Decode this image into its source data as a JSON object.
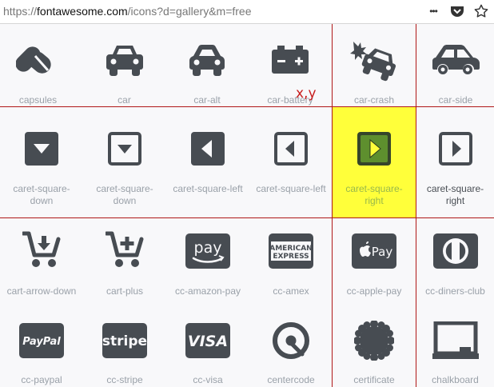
{
  "browser": {
    "url_prefix": "https://",
    "url_host": "fontawesome.com",
    "url_path": "/icons?d=gallery&m=free",
    "menu_glyph": "•••"
  },
  "annotation": {
    "coord_label": "x,y"
  },
  "colors": {
    "icon": "#474c52",
    "highlight": "#ffff3a",
    "grid_line": "#b01818"
  },
  "icons": {
    "row1": [
      "capsules",
      "car",
      "car-alt",
      "car-battery",
      "car-crash",
      "car-side"
    ],
    "row2": [
      "caret-square-\ndown",
      "caret-square-\ndown",
      "caret-square-left",
      "caret-square-left",
      "caret-square-\nright",
      "caret-square-\nright"
    ],
    "row3": [
      "cart-arrow-down",
      "cart-plus",
      "cc-amazon-pay",
      "cc-amex",
      "cc-apple-pay",
      "cc-diners-club"
    ],
    "row4": [
      "cc-paypal",
      "cc-stripe",
      "cc-visa",
      "centercode",
      "certificate",
      "chalkboard"
    ]
  },
  "logos": {
    "pay": "pay",
    "amex_top": "AMERICAN",
    "amex_bottom": "EXPRESS",
    "apple_pay": "Pay",
    "paypal": "PayPal",
    "stripe": "stripe",
    "visa": "VISA"
  }
}
